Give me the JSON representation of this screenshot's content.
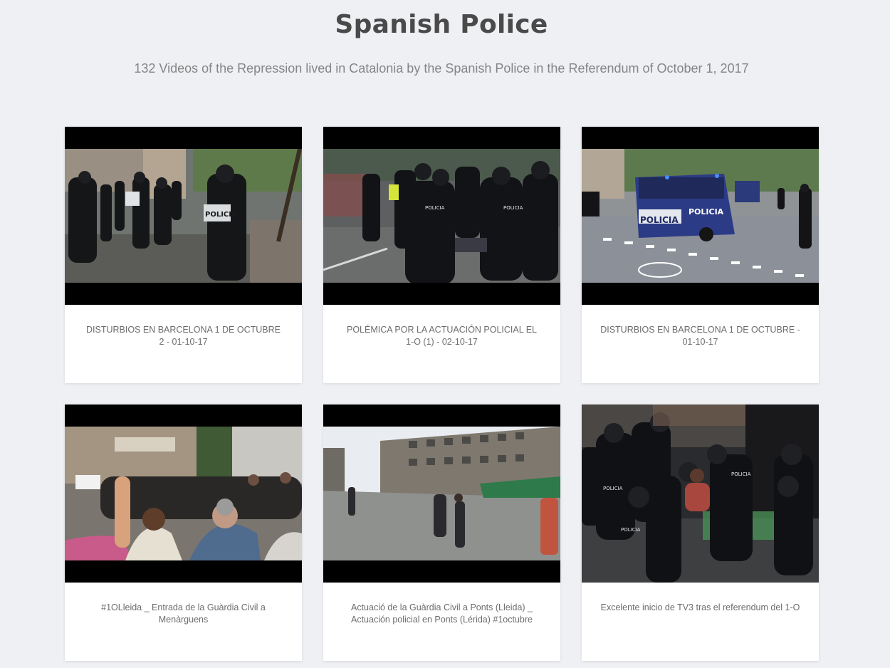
{
  "header": {
    "title": "Spanish Police",
    "subtitle": "132 Videos of the Repression lived in Catalonia by the Spanish Police in the Referendum of October 1, 2017"
  },
  "videos": [
    {
      "title": "DISTURBIOS EN BARCELONA 1 DE OCTUBRE 2 - 01-10-17"
    },
    {
      "title": "POLÉMICA POR LA ACTUACIÓN POLICIAL EL 1-O (1) - 02-10-17"
    },
    {
      "title": "DISTURBIOS EN BARCELONA 1 DE OCTUBRE - 01-10-17"
    },
    {
      "title": "#1OLleida _ Entrada de la Guàrdia Civil a Menàrguens"
    },
    {
      "title": "Actuació de la Guàrdia Civil a Ponts (Lleida) _ Actuación policial en Ponts (Lérida) #1octubre"
    },
    {
      "title": "Excelente inicio de TV3 tras el referendum del 1-O"
    }
  ]
}
